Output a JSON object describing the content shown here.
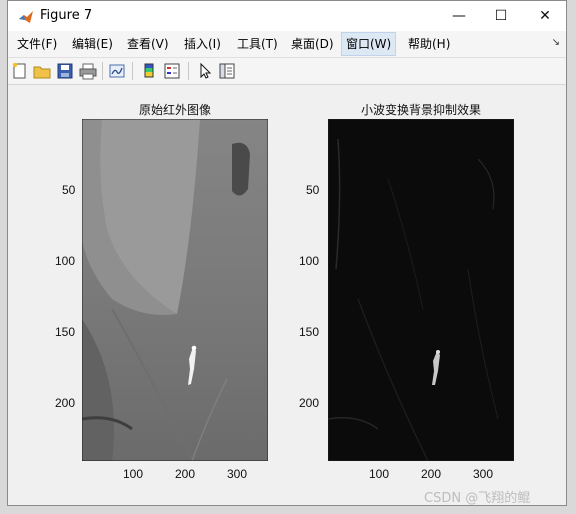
{
  "window": {
    "title": "Figure 7",
    "controls": {
      "minimize": "—",
      "maximize": "☐",
      "close": "✕"
    }
  },
  "menu": {
    "items": [
      "文件(F)",
      "编辑(E)",
      "查看(V)",
      "插入(I)",
      "工具(T)",
      "桌面(D)",
      "窗口(W)",
      "帮助(H)"
    ],
    "active": "窗口(W)",
    "overflow_arrow": "↘"
  },
  "toolbar": {
    "icons": [
      "new-figure-icon",
      "open-folder-icon",
      "save-icon",
      "print-icon",
      "link-plot-icon",
      "insert-colorbar-icon",
      "insert-legend-icon",
      "pointer-icon",
      "plot-browser-icon"
    ]
  },
  "figure": {
    "left_axes": {
      "title": "原始红外图像",
      "x_ticks": [
        "100",
        "200",
        "300"
      ],
      "y_ticks": [
        "50",
        "100",
        "150",
        "200"
      ]
    },
    "right_axes": {
      "title": "小波变换背景抑制效果",
      "x_ticks": [
        "100",
        "200",
        "300"
      ],
      "y_ticks": [
        "50",
        "100",
        "150",
        "200"
      ]
    }
  },
  "watermark": "CSDN @飞翔的鲲",
  "colors": {
    "titlebar": "#ffffff",
    "menu_active": "#dde8f5",
    "figure_bg": "#f0f0f0"
  }
}
